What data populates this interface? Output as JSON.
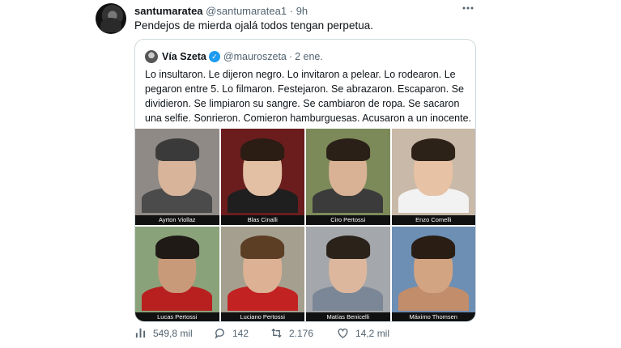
{
  "tweet": {
    "display_name": "santumaratea",
    "handle": "@santumaratea1",
    "dot": "·",
    "time": "9h",
    "text": "Pendejos de mierda ojalá todos tengan perpetua.",
    "more_icon": "more-icon"
  },
  "quote": {
    "display_name": "Vía Szeta",
    "handle": "@mauroszeta",
    "dot": "·",
    "time": "2 ene.",
    "text": "Lo insultaron. Le dijeron negro. Lo invitaron a pelear. Lo rodearon. Le pegaron entre 5. Lo filmaron. Festejaron. Se abrazaron. Escaparon. Se dividieron. Se limpiaron su sangre. Se cambiaron de ropa. Se sacaron una selfie. Sonrieron. Comieron hamburguesas. Acusaron a un inocente.",
    "photos": [
      {
        "caption": "Ayrton Viollaz",
        "bg": "#8f8a86",
        "skin": "#d7b49a",
        "hair": "#3a3a3a",
        "shirt": "#4b4b4b"
      },
      {
        "caption": "Blas Cinalli",
        "bg": "#6b1d1d",
        "skin": "#e3bfa3",
        "hair": "#2b1c14",
        "shirt": "#1f1f1f"
      },
      {
        "caption": "Ciro Pertossi",
        "bg": "#7c8a5a",
        "skin": "#d9b295",
        "hair": "#2a2017",
        "shirt": "#3b3b3b"
      },
      {
        "caption": "Enzo Comelli",
        "bg": "#c9b9a8",
        "skin": "#e7c2a5",
        "hair": "#2d2218",
        "shirt": "#f2f2f2"
      },
      {
        "caption": "Lucas Pertossi",
        "bg": "#8aa27a",
        "skin": "#c99a7a",
        "hair": "#1f1a16",
        "shirt": "#b82020"
      },
      {
        "caption": "Luciano Pertossi",
        "bg": "#a59f8f",
        "skin": "#dcb194",
        "hair": "#5c3e24",
        "shirt": "#c22222"
      },
      {
        "caption": "Matías Benicelli",
        "bg": "#a4a7ab",
        "skin": "#dcb79d",
        "hair": "#2b221a",
        "shirt": "#7b8797"
      },
      {
        "caption": "Máximo Thomsen",
        "bg": "#6d8fb3",
        "skin": "#d3a482",
        "hair": "#2a1d14",
        "shirt": "#c28d6b"
      }
    ]
  },
  "actions": {
    "views": "549,8 mil",
    "replies": "142",
    "retweets": "2.176",
    "likes": "14,2 mil"
  }
}
